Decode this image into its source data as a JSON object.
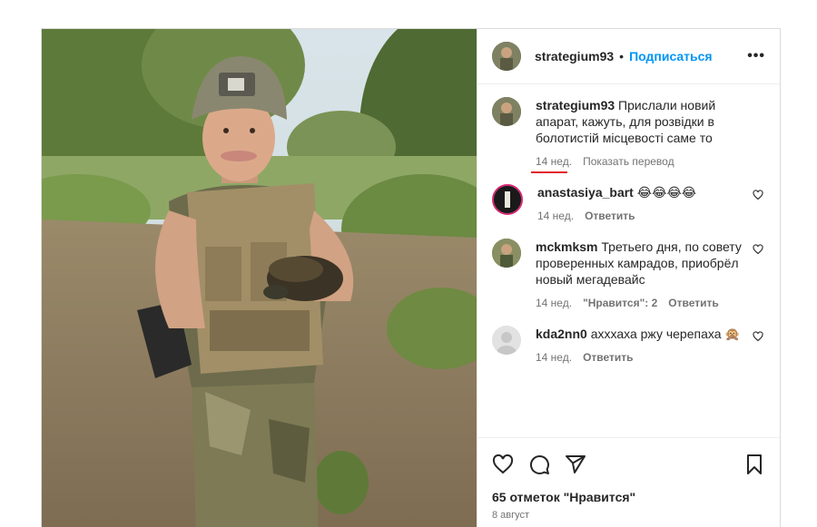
{
  "header": {
    "username": "strategium93",
    "separator": "•",
    "follow_label": "Подписаться",
    "more_label": "•••"
  },
  "caption": {
    "username": "strategium93",
    "text": "Прислали новий апарат, кажуть, для розвідки в болотистій місцевості саме то",
    "time": "14 нед.",
    "translate_label": "Показать перевод"
  },
  "comments": [
    {
      "username": "anastasiya_bart",
      "text": "😂😂😂😂",
      "time": "14 нед.",
      "likes": "",
      "reply": "Ответить"
    },
    {
      "username": "mckmksm",
      "text": "Третьего дня, по совету проверенных камрадов, приобрёл новый мегадевайс",
      "time": "14 нед.",
      "likes": "\"Нравится\": 2",
      "reply": "Ответить"
    },
    {
      "username": "kda2nn0",
      "text": "ахххаха ржу черепаха 🙊",
      "time": "14 нед.",
      "likes": "",
      "reply": "Ответить"
    }
  ],
  "footer": {
    "likes": "65 отметок \"Нравится\"",
    "date": "8 август"
  },
  "colors": {
    "accent": "#0095f6",
    "underline": "#e0232b",
    "muted": "#737373"
  },
  "icons": [
    "more-icon",
    "heart-icon",
    "comment-icon",
    "share-icon",
    "bookmark-icon"
  ]
}
